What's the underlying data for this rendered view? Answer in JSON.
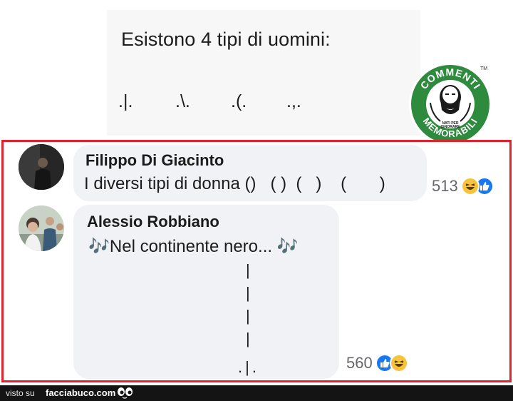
{
  "post": {
    "title": "Esistono 4 tipi di uomini:",
    "symbols": [
      ".|.",
      ".\\.",
      ".(.",
      ".,."
    ]
  },
  "badge": {
    "top_text": "COMMENTI",
    "bottom_text": "MEMORABILI",
    "tagline_1": "NATI PER",
    "tagline_2": "IGNORARE",
    "trademark": "TM",
    "green": "#2e8b3e"
  },
  "comments": [
    {
      "author": "Filippo Di Giacinto",
      "text": "I diversi tipi di donna ()   ( )  (   )    (       )",
      "reaction_count": "513",
      "reactions": [
        "haha-icon",
        "like-icon"
      ]
    },
    {
      "author": "Alessio Robbiano",
      "text": "🎶Nel continente nero... 🎶",
      "lines": [
        "|",
        "|",
        "|",
        "|"
      ],
      "line_end": ".|.",
      "reaction_count": "560",
      "reactions": [
        "like-icon",
        "haha-icon"
      ]
    }
  ],
  "footer": {
    "visto": "visto su",
    "site": "facciabuco.com"
  },
  "colors": {
    "frame": "#e0232d",
    "bubble": "#f0f2f5",
    "like": "#1877f2",
    "haha": "#f7c33c"
  }
}
